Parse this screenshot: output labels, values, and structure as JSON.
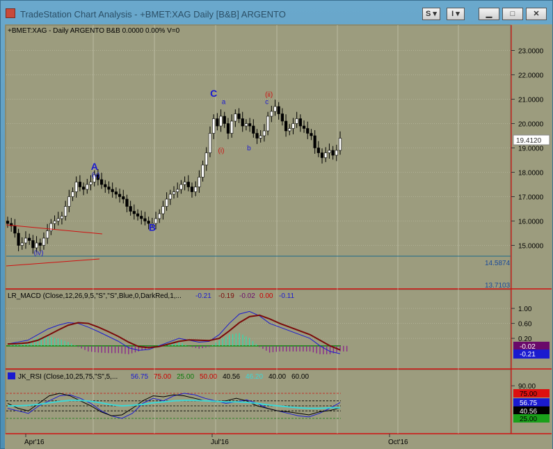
{
  "window": {
    "title": "TradeStation Chart Analysis - +BMET:XAG Daily [B&B] ARGENTO",
    "buttons": {
      "style": "S",
      "indicator": "I"
    }
  },
  "colors": {
    "background": "#9c9c7e",
    "up_candle": "#ffffff",
    "down_candle": "#000000",
    "grid": "#c8c8b0",
    "wave_major": "#1a1ad0",
    "wave_minor": "#cc1010",
    "trendline": "#d01010",
    "support_line": "#1a6a8a"
  },
  "price_panel": {
    "header": "+BMET:XAG - Daily  ARGENTO  B&B  0.0000  0.00%  V=0",
    "last_price": "19.4120",
    "levels": [
      "14.5874",
      "13.7103"
    ]
  },
  "chart_data": [
    {
      "type": "candlestick",
      "name": "+BMET:XAG Daily",
      "x_ticks": [
        "Apr'16",
        "Jul'16",
        "Oct'16"
      ],
      "ylim": [
        13.5,
        23.5
      ],
      "y_ticks": [
        "23.0000",
        "22.0000",
        "21.0000",
        "20.0000",
        "19.0000",
        "18.0000",
        "17.0000",
        "16.0000",
        "15.0000"
      ],
      "close": [
        15.9,
        15.8,
        15.5,
        15.0,
        15.1,
        15.3,
        15.2,
        14.9,
        15.1,
        15.0,
        15.3,
        15.6,
        15.9,
        16.0,
        16.1,
        16.2,
        16.6,
        17.0,
        17.2,
        17.6,
        17.4,
        17.3,
        17.5,
        17.6,
        17.9,
        17.7,
        17.5,
        17.4,
        17.3,
        17.2,
        17.1,
        17.0,
        16.9,
        16.6,
        16.4,
        16.3,
        16.2,
        16.1,
        16.0,
        15.9,
        15.9,
        16.1,
        16.3,
        16.6,
        16.9,
        17.1,
        17.2,
        17.3,
        17.5,
        17.6,
        17.4,
        17.2,
        17.4,
        17.8,
        18.3,
        18.8,
        19.6,
        20.2,
        19.9,
        20.3,
        20.0,
        19.6,
        20.1,
        20.4,
        20.2,
        19.9,
        20.0,
        19.9,
        19.6,
        19.4,
        19.5,
        19.7,
        20.3,
        20.5,
        20.7,
        20.4,
        20.1,
        19.7,
        19.8,
        20.0,
        20.2,
        19.9,
        19.8,
        19.6,
        19.5,
        19.0,
        18.8,
        18.6,
        18.8,
        18.9,
        18.7,
        18.9,
        19.4
      ],
      "wave_labels": [
        {
          "text": "A",
          "x_index": 24,
          "price": 18.1,
          "color": "blue"
        },
        {
          "text": "(v)",
          "x_index": 24,
          "price": 17.8,
          "color": "blue"
        },
        {
          "text": "B",
          "x_index": 40,
          "price": 15.6,
          "color": "blue"
        },
        {
          "text": "(iv)",
          "x_index": 8,
          "price": 14.6,
          "color": "blue"
        },
        {
          "text": "C",
          "x_index": 57,
          "price": 21.1,
          "color": "blue"
        },
        {
          "text": "a",
          "x_index": 60,
          "price": 20.8,
          "color": "blue"
        },
        {
          "text": "(i)",
          "x_index": 59,
          "price": 18.8,
          "color": "red"
        },
        {
          "text": "b",
          "x_index": 67,
          "price": 18.9,
          "color": "blue"
        },
        {
          "text": "(ii)",
          "x_index": 72,
          "price": 21.1,
          "color": "red"
        },
        {
          "text": "c",
          "x_index": 72,
          "price": 20.8,
          "color": "blue"
        }
      ]
    },
    {
      "type": "line",
      "name": "LR_MACD",
      "title": "LR_MACD (Close,12,26,9,5,\"S\",\"S\",Blue,0,DarkRed,1,...",
      "values_text": [
        "-0.21",
        "-0.19",
        "-0.02",
        "0.00",
        "-0.11"
      ],
      "ylim": [
        -0.45,
        1.15
      ],
      "y_ticks": [
        "1.00",
        "0.60",
        "0.20"
      ],
      "badges": [
        "-0.02",
        "-0.21"
      ],
      "series": [
        {
          "name": "MACD",
          "color": "#1a1ad0",
          "values": [
            0.05,
            0.1,
            0.15,
            0.3,
            0.45,
            0.55,
            0.62,
            0.6,
            0.5,
            0.38,
            0.25,
            0.12,
            -0.05,
            -0.12,
            -0.1,
            0.0,
            0.1,
            0.2,
            0.15,
            0.1,
            0.12,
            0.3,
            0.6,
            0.85,
            0.92,
            0.8,
            0.6,
            0.5,
            0.4,
            0.3,
            0.2,
            0.0,
            -0.15,
            -0.21
          ]
        },
        {
          "name": "Signal",
          "color": "#7a0a0a",
          "values": [
            0.05,
            0.06,
            0.08,
            0.15,
            0.28,
            0.42,
            0.55,
            0.62,
            0.6,
            0.5,
            0.38,
            0.25,
            0.1,
            -0.02,
            -0.05,
            -0.02,
            0.05,
            0.12,
            0.16,
            0.15,
            0.14,
            0.2,
            0.4,
            0.62,
            0.78,
            0.82,
            0.72,
            0.6,
            0.5,
            0.4,
            0.3,
            0.15,
            0.0,
            -0.11
          ]
        }
      ]
    },
    {
      "type": "line",
      "name": "JK_RSI",
      "title": "JK_RSI (Close,10,25,75,\"S\",5,...",
      "values_text": [
        "56.75",
        "75.00",
        "25.00",
        "50.00",
        "40.56",
        "46.20",
        "40.00",
        "60.00"
      ],
      "ylim": [
        0,
        100
      ],
      "y_ticks": [
        "90.00"
      ],
      "badges": [
        "75.00",
        "56.75",
        "40.56",
        "25.00"
      ],
      "levels": [
        75,
        60,
        50,
        40,
        25
      ],
      "series": [
        {
          "name": "RSI",
          "color": "#1a1ad0",
          "values": [
            45,
            40,
            35,
            50,
            60,
            70,
            72,
            65,
            55,
            40,
            30,
            25,
            35,
            55,
            65,
            60,
            70,
            75,
            72,
            65,
            60,
            55,
            58,
            62,
            55,
            45,
            40,
            35,
            30,
            28,
            35,
            45,
            56.75
          ]
        },
        {
          "name": "Stoch",
          "color": "#000000",
          "values": [
            55,
            45,
            40,
            55,
            70,
            75,
            70,
            60,
            50,
            38,
            30,
            32,
            45,
            60,
            70,
            68,
            72,
            70,
            65,
            60,
            58,
            60,
            65,
            60,
            50,
            45,
            40,
            38,
            35,
            32,
            38,
            40.56,
            46
          ]
        },
        {
          "name": "Average",
          "color": "#3ad8d8",
          "values": [
            50,
            50,
            51,
            53,
            56,
            59,
            61,
            61,
            59,
            56,
            52,
            50,
            51,
            53,
            56,
            58,
            60,
            61,
            61,
            60,
            59,
            58,
            58,
            57,
            55,
            52,
            50,
            48,
            46,
            45,
            45,
            46,
            46.2
          ]
        }
      ]
    }
  ]
}
